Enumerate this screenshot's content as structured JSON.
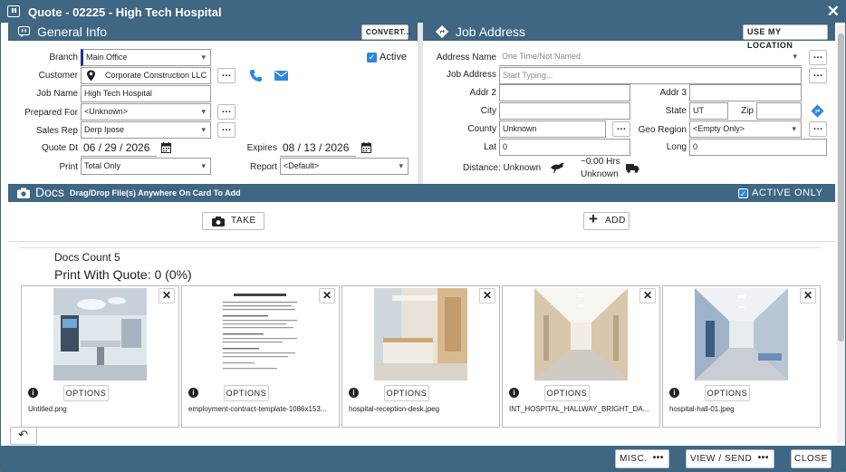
{
  "window": {
    "title": "Quote - 02225 - High Tech Hospital"
  },
  "general_info": {
    "title": "General Info",
    "convert_label": "CONVERT...",
    "active_label": "Active",
    "branch_label": "Branch",
    "branch_value": "Main Office",
    "customer_label": "Customer",
    "customer_value": "Corporate Construction LLC",
    "job_name_label": "Job Name",
    "job_name_value": "High Tech Hospital",
    "prepared_for_label": "Prepared For",
    "prepared_for_value": "<Unknown>",
    "sales_rep_label": "Sales Rep",
    "sales_rep_value": "Derp Ipose",
    "quote_dt_label": "Quote Dt",
    "quote_dt_value": "06 / 29 / 2026",
    "expires_label": "Expires",
    "expires_value": "08 / 13 / 2026",
    "print_label": "Print",
    "print_value": "Total Only",
    "report_label": "Report",
    "report_value": "<Default>"
  },
  "job_address": {
    "title": "Job Address",
    "use_location_label": "USE MY LOCATION",
    "address_name_label": "Address Name",
    "address_name_placeholder": "One Time/Not Named",
    "job_address_label": "Job Address",
    "job_address_placeholder": "Start Typing...",
    "addr2_label": "Addr 2",
    "addr3_label": "Addr 3",
    "city_label": "City",
    "state_label": "State",
    "state_value": "UT",
    "zip_label": "Zip",
    "county_label": "County",
    "county_value": "Unknown",
    "geo_region_label": "Geo Region",
    "geo_region_value": "<Empty Only>",
    "lat_label": "Lat",
    "lat_value": "0",
    "long_label": "Long",
    "long_value": "0",
    "distance_label": "Distance: Unknown",
    "hrs_label": "~0:00 Hrs",
    "hrs_unknown": "Unknown"
  },
  "docs": {
    "title": "Docs",
    "subtitle": "Drag/Drop File(s) Anywhere On Card To Add",
    "active_only_label": "ACTIVE ONLY",
    "take_label": "TAKE",
    "add_label": "ADD",
    "count_text": "Docs Count 5",
    "print_with_quote_text": "Print With Quote: 0 (0%)",
    "option_label": "OPTIONS",
    "files": [
      {
        "name": "Untitled.png",
        "kind": "operating-room"
      },
      {
        "name": "employment-contract-template-1086x153...",
        "kind": "document"
      },
      {
        "name": "hospital-reception-desk.jpeg",
        "kind": "reception"
      },
      {
        "name": "INT_HOSPITAL_HALLWAY_BRIGHT_DA...",
        "kind": "hallway"
      },
      {
        "name": "hospital-hall-01.jpeg",
        "kind": "hall"
      }
    ]
  },
  "footer": {
    "misc_label": "MISC.",
    "view_send_label": "VIEW / SEND",
    "close_label": "CLOSE"
  },
  "colors": {
    "header": "#3f6682",
    "accent": "#2e86de"
  }
}
